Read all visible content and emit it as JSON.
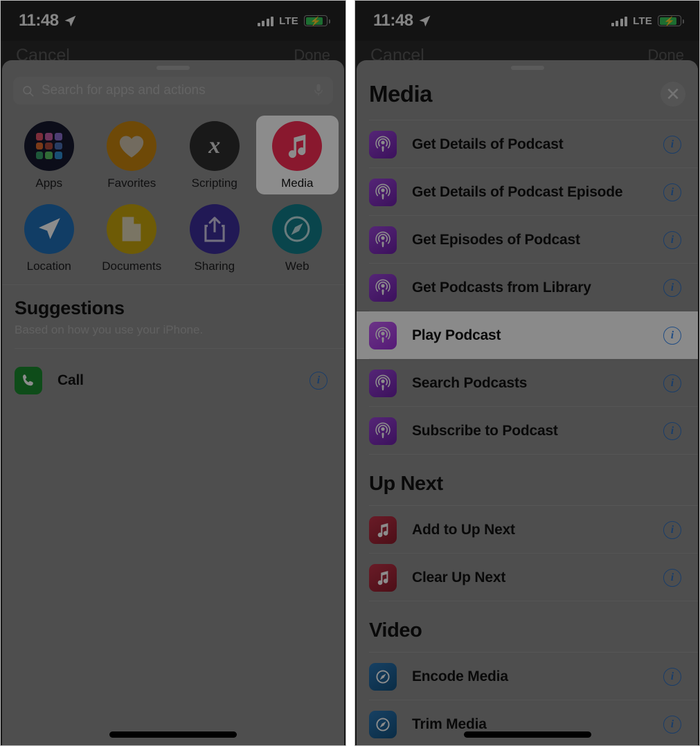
{
  "status_bar": {
    "time": "11:48",
    "location_icon": "location-arrow-icon",
    "carrier_tech": "LTE",
    "signal_icon": "cellular-bars-icon",
    "battery_icon": "battery-charging-icon"
  },
  "left_panel": {
    "underlying_nav": {
      "cancel_label": "Cancel",
      "done_label": "Done"
    },
    "search": {
      "placeholder": "Search for apps and actions",
      "value": "",
      "search_icon": "search-icon",
      "mic_icon": "microphone-icon"
    },
    "categories": [
      {
        "label": "Apps",
        "icon": "apps-grid-icon",
        "color": "#16182e",
        "selected": false
      },
      {
        "label": "Favorites",
        "icon": "heart-icon",
        "color": "#c8860d",
        "selected": false
      },
      {
        "label": "Scripting",
        "icon": "x-variable-icon",
        "color": "#2f2f2f",
        "selected": false
      },
      {
        "label": "Media",
        "icon": "music-note-icon",
        "color": "#fa2d55",
        "selected": true
      },
      {
        "label": "Location",
        "icon": "navigation-arrow-icon",
        "color": "#1f6fb8",
        "selected": false
      },
      {
        "label": "Documents",
        "icon": "document-icon",
        "color": "#c9a70c",
        "selected": false
      },
      {
        "label": "Sharing",
        "icon": "share-up-icon",
        "color": "#3d2f9c",
        "selected": false
      },
      {
        "label": "Web",
        "icon": "compass-safari-icon",
        "color": "#127f8a",
        "selected": false
      }
    ],
    "suggestions": {
      "title": "Suggestions",
      "subtitle": "Based on how you use your iPhone.",
      "items": [
        {
          "label": "Call",
          "icon": "phone-icon",
          "color": "#1a8a2e",
          "info_icon": "info-icon"
        }
      ]
    }
  },
  "right_panel": {
    "title": "Media",
    "close_icon": "close-icon",
    "sections": [
      {
        "heading": "",
        "items": [
          {
            "label": "Get Details of Podcast",
            "icon": "podcast-icon",
            "color": "#7b2fb5",
            "info_icon": "info-icon",
            "highlighted": false
          },
          {
            "label": "Get Details of Podcast Episode",
            "icon": "podcast-icon",
            "color": "#7b2fb5",
            "info_icon": "info-icon",
            "highlighted": false
          },
          {
            "label": "Get Episodes of Podcast",
            "icon": "podcast-icon",
            "color": "#7b2fb5",
            "info_icon": "info-icon",
            "highlighted": false
          },
          {
            "label": "Get Podcasts from Library",
            "icon": "podcast-icon",
            "color": "#7b2fb5",
            "info_icon": "info-icon",
            "highlighted": false
          },
          {
            "label": "Play Podcast",
            "icon": "podcast-icon",
            "color": "#b249e8",
            "info_icon": "info-icon",
            "highlighted": true
          },
          {
            "label": "Search Podcasts",
            "icon": "podcast-icon",
            "color": "#7b2fb5",
            "info_icon": "info-icon",
            "highlighted": false
          },
          {
            "label": "Subscribe to Podcast",
            "icon": "podcast-icon",
            "color": "#7b2fb5",
            "info_icon": "info-icon",
            "highlighted": false
          }
        ]
      },
      {
        "heading": "Up Next",
        "items": [
          {
            "label": "Add to Up Next",
            "icon": "music-note-icon",
            "color": "#9e2233",
            "info_icon": "info-icon",
            "highlighted": false
          },
          {
            "label": "Clear Up Next",
            "icon": "music-note-icon",
            "color": "#9e2233",
            "info_icon": "info-icon",
            "highlighted": false
          }
        ]
      },
      {
        "heading": "Video",
        "items": [
          {
            "label": "Encode Media",
            "icon": "gauge-icon",
            "color": "#1b5e96",
            "info_icon": "info-icon",
            "highlighted": false
          },
          {
            "label": "Trim Media",
            "icon": "gauge-icon",
            "color": "#1b5e96",
            "info_icon": "info-icon",
            "highlighted": false
          }
        ]
      }
    ]
  },
  "colors": {
    "accent_blue": "#007AFF",
    "media_pink": "#FA2D55",
    "podcast_purple": "#7B2FB5",
    "sheet_bg": "#8E8E8E",
    "dim_overlay": "rgba(0,0,0,0.45)"
  }
}
